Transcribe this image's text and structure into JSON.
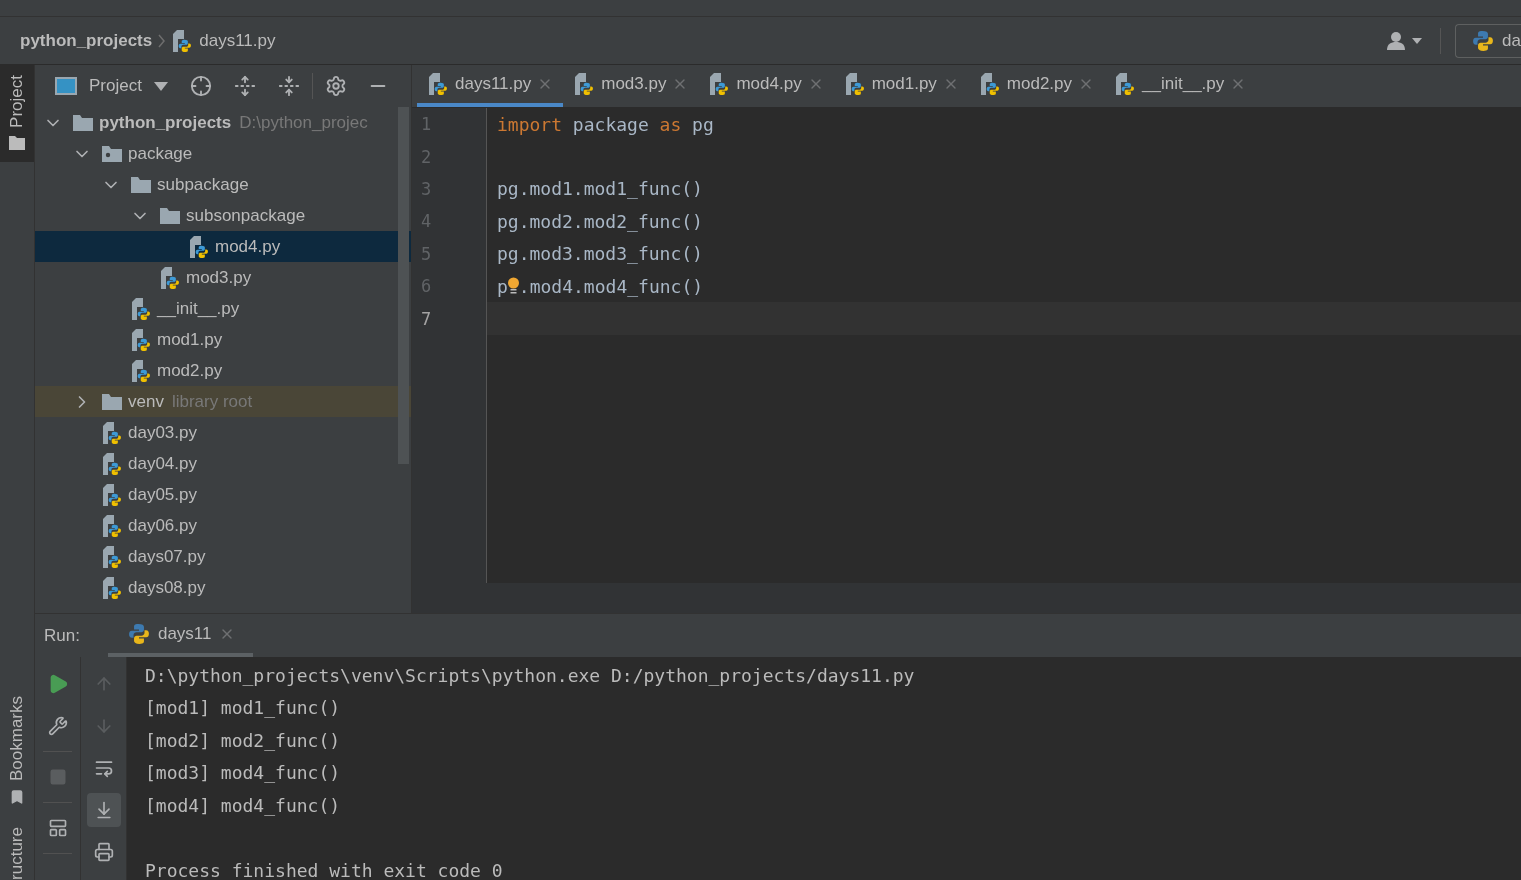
{
  "breadcrumb": {
    "items": [
      {
        "kind": "folder",
        "label": "python_projects"
      },
      {
        "kind": "file",
        "label": "days11.py"
      }
    ],
    "run_config": "da"
  },
  "tool_stripe": {
    "top": [
      {
        "kind": "project",
        "label": "Project",
        "selected": true
      }
    ],
    "bottom": [
      {
        "kind": "bookmarks",
        "label": "Bookmarks",
        "selected": false
      },
      {
        "kind": "structure",
        "label": "ructure",
        "selected": false
      }
    ]
  },
  "project_panel": {
    "title": "Project",
    "tree": [
      {
        "kind": "folder",
        "label": "python_projects",
        "hint": "D:\\python_projec",
        "selected": false,
        "expanded": true,
        "children": [
          {
            "kind": "package",
            "label": "package",
            "selected": false,
            "expanded": true,
            "children": [
              {
                "kind": "folder",
                "label": "subpackage",
                "selected": false,
                "expanded": true,
                "children": [
                  {
                    "kind": "folder",
                    "label": "subsonpackage",
                    "selected": false,
                    "expanded": true,
                    "children": [
                      {
                        "kind": "file",
                        "label": "mod4.py",
                        "selected": true
                      }
                    ]
                  },
                  {
                    "kind": "file",
                    "label": "mod3.py",
                    "selected": false
                  }
                ]
              },
              {
                "kind": "file",
                "label": "__init__.py",
                "selected": false
              },
              {
                "kind": "file",
                "label": "mod1.py",
                "selected": false
              },
              {
                "kind": "file",
                "label": "mod2.py",
                "selected": false
              }
            ]
          },
          {
            "kind": "library",
            "label": "venv",
            "hint": "library root",
            "selected": false,
            "expanded": false
          },
          {
            "kind": "file",
            "label": "day03.py",
            "selected": false
          },
          {
            "kind": "file",
            "label": "day04.py",
            "selected": false
          },
          {
            "kind": "file",
            "label": "day05.py",
            "selected": false
          },
          {
            "kind": "file",
            "label": "day06.py",
            "selected": false
          },
          {
            "kind": "file",
            "label": "days07.py",
            "selected": false
          },
          {
            "kind": "file",
            "label": "days08.py",
            "selected": false
          }
        ]
      }
    ]
  },
  "editor": {
    "tabs": [
      {
        "label": "days11.py",
        "selected": true
      },
      {
        "label": "mod3.py",
        "selected": false
      },
      {
        "label": "mod4.py",
        "selected": false
      },
      {
        "label": "mod1.py",
        "selected": false
      },
      {
        "label": "mod2.py",
        "selected": false
      },
      {
        "label": "__init__.py",
        "selected": false
      }
    ],
    "lines": [
      {
        "number": "1",
        "current": false,
        "tokens": [
          {
            "kind": "keyword",
            "text": "import"
          },
          {
            "kind": "plain",
            "text": " package "
          },
          {
            "kind": "keyword",
            "text": "as"
          },
          {
            "kind": "plain",
            "text": " pg"
          }
        ]
      },
      {
        "number": "2",
        "current": false
      },
      {
        "number": "3",
        "current": false,
        "tokens": [
          {
            "kind": "plain",
            "text": "pg.mod1.mod1_func()"
          }
        ]
      },
      {
        "number": "4",
        "current": false,
        "tokens": [
          {
            "kind": "plain",
            "text": "pg.mod2.mod2_func()"
          }
        ]
      },
      {
        "number": "5",
        "current": false,
        "tokens": [
          {
            "kind": "plain",
            "text": "pg.mod3.mod3_func()"
          }
        ]
      },
      {
        "number": "6",
        "current": false,
        "tokens": [
          {
            "kind": "plain",
            "text": "p"
          },
          {
            "kind": "bulb"
          },
          {
            "kind": "plain",
            "text": ".mod4.mod4_func()"
          }
        ]
      },
      {
        "number": "7",
        "current": true
      }
    ]
  },
  "run": {
    "label": "Run:",
    "tabs": [
      {
        "label": "days11",
        "selected": true
      }
    ],
    "toolbar_main": [
      {
        "kind": "run",
        "disabled": false
      },
      {
        "kind": "wrench",
        "disabled": false
      },
      {
        "kind": "separator"
      },
      {
        "kind": "stop",
        "disabled": true
      },
      {
        "kind": "separator"
      },
      {
        "kind": "layout",
        "disabled": false
      },
      {
        "kind": "separator"
      }
    ],
    "toolbar_console": [
      {
        "kind": "up",
        "disabled": true,
        "on": false
      },
      {
        "kind": "down",
        "disabled": true,
        "on": false
      },
      {
        "kind": "wrap",
        "disabled": false,
        "on": false
      },
      {
        "kind": "scroll-end",
        "disabled": false,
        "on": true
      },
      {
        "kind": "print",
        "disabled": false,
        "on": false
      }
    ],
    "output": [
      "D:\\python_projects\\venv\\Scripts\\python.exe D:/python_projects/days11.py",
      "[mod1] mod1_func()",
      "[mod2] mod2_func()",
      "[mod3] mod4_func()",
      "[mod4] mod4_func()"
    ],
    "exit_message": "Process finished with exit code 0"
  }
}
